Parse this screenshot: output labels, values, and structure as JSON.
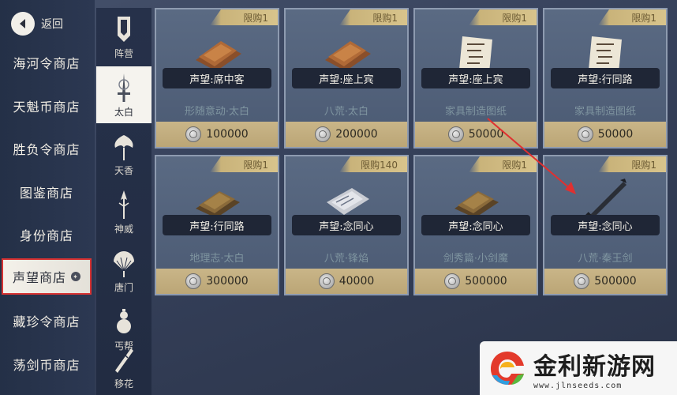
{
  "nav": {
    "back_label": "返回"
  },
  "sidebar": {
    "items": [
      {
        "label": "海河令商店"
      },
      {
        "label": "天魁币商店"
      },
      {
        "label": "胜负令商店"
      },
      {
        "label": "图鉴商店"
      },
      {
        "label": "身份商店"
      },
      {
        "label": "声望商店",
        "active": true
      },
      {
        "label": "藏珍令商店"
      },
      {
        "label": "荡剑币商店"
      }
    ]
  },
  "sects": [
    {
      "label": "阵营"
    },
    {
      "label": "太白",
      "active": true
    },
    {
      "label": "天香"
    },
    {
      "label": "神威"
    },
    {
      "label": "唐门"
    },
    {
      "label": "丐帮"
    },
    {
      "label": "移花"
    }
  ],
  "items": [
    {
      "limit": "限购1",
      "requirement": "声望:席中客",
      "name": "形随意动·太白",
      "price": "100000",
      "art": "book-icon"
    },
    {
      "limit": "限购1",
      "requirement": "声望:座上宾",
      "name": "八荒·太白",
      "price": "200000",
      "art": "book-icon"
    },
    {
      "limit": "限购1",
      "requirement": "声望:座上宾",
      "name": "家具制造图纸",
      "price": "50000",
      "art": "scroll-icon"
    },
    {
      "limit": "限购1",
      "requirement": "声望:行同路",
      "name": "家具制造图纸",
      "price": "50000",
      "art": "scroll-icon"
    },
    {
      "limit": "限购1",
      "requirement": "声望:行同路",
      "name": "地理志·太白",
      "price": "300000",
      "art": "book-icon"
    },
    {
      "limit": "限购140",
      "requirement": "声望:念同心",
      "name": "八荒·锋焰",
      "price": "40000",
      "art": "paper-icon"
    },
    {
      "limit": "限购1",
      "requirement": "声望:念同心",
      "name": "剑秀篇·小剑魔",
      "price": "500000",
      "art": "book-icon"
    },
    {
      "limit": "限购1",
      "requirement": "声望:念同心",
      "name": "八荒·秦王剑",
      "price": "500000",
      "art": "sword-icon"
    }
  ],
  "watermark": {
    "title": "金利新游网",
    "url": "www.jlnseeds.com"
  },
  "colors": {
    "active_border": "#d83333",
    "price_bar": "#c9b588",
    "limit_tag": "#d8c48c",
    "arrow": "#e03030"
  }
}
